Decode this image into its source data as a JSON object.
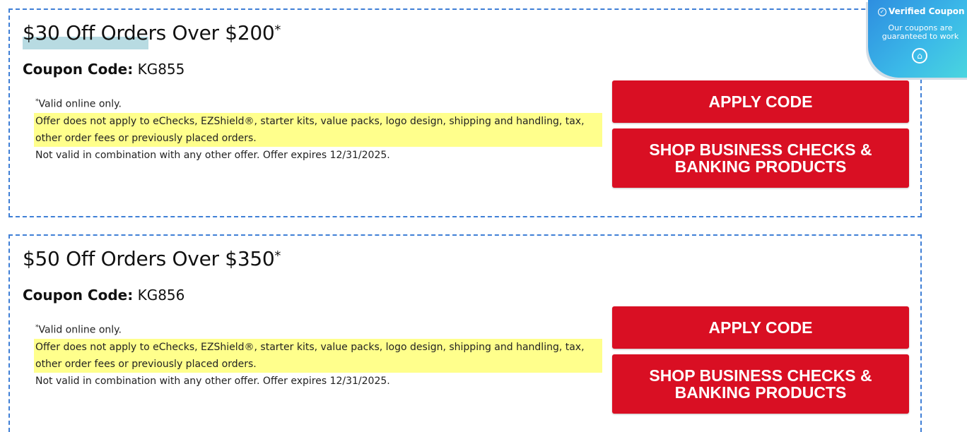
{
  "coupons": [
    {
      "title": "$30 Off Orders Over $200",
      "title_mark": "*",
      "code_label": "Coupon Code:",
      "code_value": "KG855",
      "terms": {
        "valid_mark": "*",
        "valid": "Valid online only.",
        "exclusion_line1": "Offer does not apply to eChecks, EZShield®, starter kits, value packs, logo design, shipping and handling, tax,",
        "exclusion_line2": "other order fees or previously placed orders.",
        "combination": "Not valid in combination with any other offer. Offer expires 12/31/2025."
      },
      "apply_label": "APPLY CODE",
      "shop_label_line1": "SHOP BUSINESS CHECKS &",
      "shop_label_line2": "BANKING PRODUCTS"
    },
    {
      "title": "$50 Off Orders Over $350",
      "title_mark": "*",
      "code_label": "Coupon Code:",
      "code_value": "KG856",
      "terms": {
        "valid_mark": "*",
        "valid": "Valid online only.",
        "exclusion_line1": "Offer does not apply to eChecks, EZShield®, starter kits, value packs, logo design, shipping and handling, tax,",
        "exclusion_line2": "other order fees or previously placed orders.",
        "combination": "Not valid in combination with any other offer. Offer expires 12/31/2025."
      },
      "apply_label": "APPLY CODE",
      "shop_label_line1": "SHOP BUSINESS CHECKS &",
      "shop_label_line2": "BANKING PRODUCTS"
    }
  ],
  "verified_badge": {
    "title": "Verified Coupon",
    "subtitle": "Our coupons are guaranteed to work",
    "icons": [
      "check-circle-icon",
      "shield-house-icon"
    ]
  },
  "colors": {
    "button_red": "#d90f23",
    "dashed_border": "#3f7fd6",
    "terms_highlight": "#ffff8c",
    "title_highlight": "#b8dbe2",
    "badge_gradient_start": "#2e8ee0",
    "badge_gradient_end": "#4bd8de"
  }
}
